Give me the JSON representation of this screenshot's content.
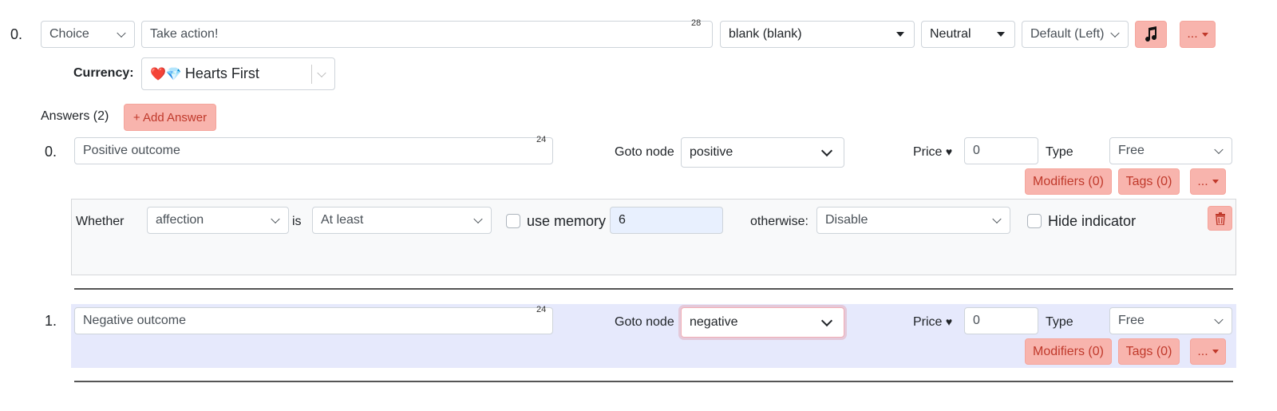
{
  "node": {
    "index": "0.",
    "type_select": "Choice",
    "text_input": "Take action!",
    "text_counter": "28",
    "speaker_select": "blank (blank)",
    "emotion_select": "Neutral",
    "position_select": "Default (Left)",
    "more_label": "...",
    "currency_label": "Currency:",
    "currency_value": "Hearts First",
    "currency_emoji": "❤️💎"
  },
  "answers": {
    "heading": "Answers (2)",
    "add_label": "+ Add Answer",
    "items": [
      {
        "index": "0.",
        "text": "Positive outcome",
        "counter": "24",
        "goto_label": "Goto node",
        "goto_value": "positive",
        "price_label": "Price",
        "price_value": "0",
        "type_label": "Type",
        "type_value": "Free",
        "modifiers_label": "Modifiers (0)",
        "tags_label": "Tags (0)",
        "more_label": "...",
        "condition": {
          "whether_label": "Whether",
          "variable": "affection",
          "is_label": "is",
          "comparator": "At least",
          "use_memory_label": "use memory",
          "use_memory_checked": false,
          "value": "6",
          "otherwise_label": "otherwise:",
          "otherwise_value": "Disable",
          "hide_indicator_label": "Hide indicator",
          "hide_indicator_checked": false
        }
      },
      {
        "index": "1.",
        "text": "Negative outcome",
        "counter": "24",
        "goto_label": "Goto node",
        "goto_value": "negative",
        "price_label": "Price",
        "price_value": "0",
        "type_label": "Type",
        "type_value": "Free",
        "modifiers_label": "Modifiers (0)",
        "tags_label": "Tags (0)",
        "more_label": "..."
      }
    ]
  },
  "colors": {
    "accent_button_bg": "#f8b4ad",
    "accent_button_text": "#c0392b",
    "selected_row_bg": "#e6e9fc",
    "condition_panel_bg": "#f8f9fa",
    "input_highlight_bg": "#e8f0fe"
  }
}
